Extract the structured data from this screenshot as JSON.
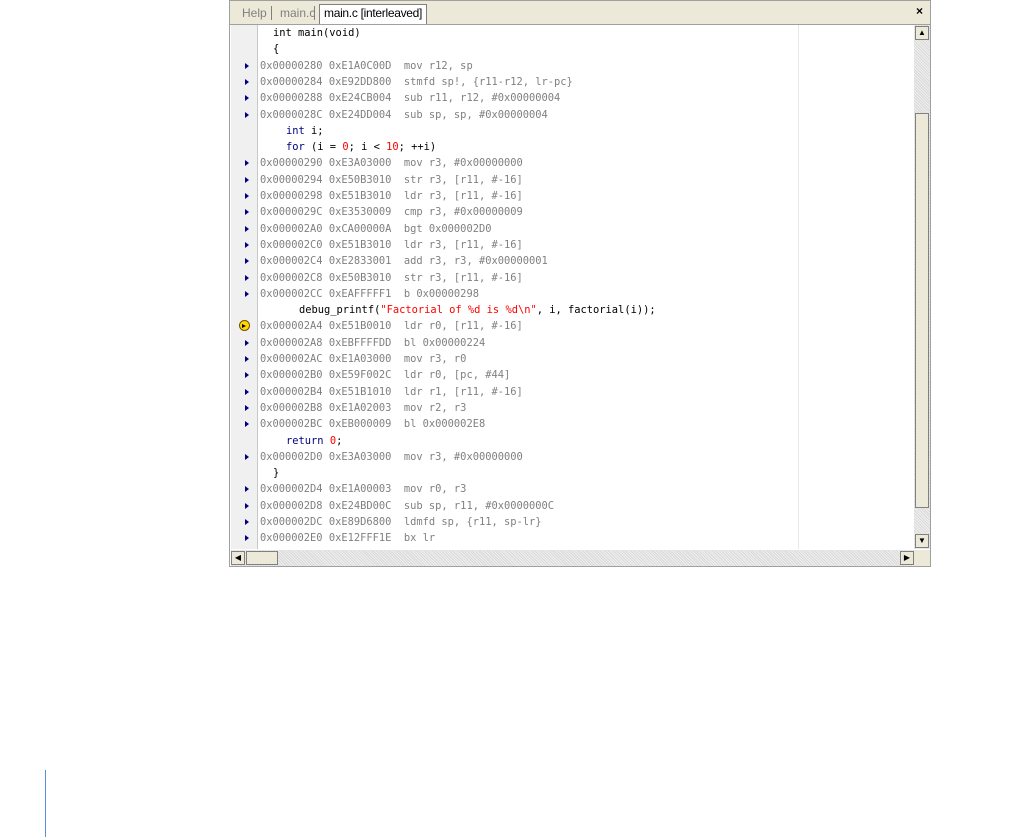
{
  "tabs": [
    {
      "label": "Help",
      "active": false
    },
    {
      "label": "main.c",
      "active": false
    },
    {
      "label": "main.c [interleaved]",
      "active": true
    }
  ],
  "close_glyph": "×",
  "lines": [
    {
      "kind": "src",
      "indent": 1,
      "tokens": [
        {
          "t": "int main(void)",
          "c": "src"
        }
      ]
    },
    {
      "kind": "src",
      "indent": 1,
      "tokens": [
        {
          "t": "{",
          "c": "src"
        }
      ]
    },
    {
      "kind": "asm",
      "text": "0x00000280 0xE1A0C00D  mov r12, sp"
    },
    {
      "kind": "asm",
      "text": "0x00000284 0xE92DD800  stmfd sp!, {r11-r12, lr-pc}"
    },
    {
      "kind": "asm",
      "text": "0x00000288 0xE24CB004  sub r11, r12, #0x00000004"
    },
    {
      "kind": "asm",
      "text": "0x0000028C 0xE24DD004  sub sp, sp, #0x00000004"
    },
    {
      "kind": "src",
      "indent": 2,
      "tokens": [
        {
          "t": "int",
          "c": "kw"
        },
        {
          "t": " i;",
          "c": "src"
        }
      ]
    },
    {
      "kind": "src",
      "indent": 2,
      "tokens": [
        {
          "t": "for",
          "c": "kw"
        },
        {
          "t": " (i = ",
          "c": "src"
        },
        {
          "t": "0",
          "c": "num"
        },
        {
          "t": "; i < ",
          "c": "src"
        },
        {
          "t": "10",
          "c": "num"
        },
        {
          "t": "; ++i)",
          "c": "src"
        }
      ]
    },
    {
      "kind": "asm",
      "text": "0x00000290 0xE3A03000  mov r3, #0x00000000"
    },
    {
      "kind": "asm",
      "text": "0x00000294 0xE50B3010  str r3, [r11, #-16]"
    },
    {
      "kind": "asm",
      "text": "0x00000298 0xE51B3010  ldr r3, [r11, #-16]"
    },
    {
      "kind": "asm",
      "text": "0x0000029C 0xE3530009  cmp r3, #0x00000009"
    },
    {
      "kind": "asm",
      "text": "0x000002A0 0xCA00000A  bgt 0x000002D0"
    },
    {
      "kind": "asm",
      "text": "0x000002C0 0xE51B3010  ldr r3, [r11, #-16]"
    },
    {
      "kind": "asm",
      "text": "0x000002C4 0xE2833001  add r3, r3, #0x00000001"
    },
    {
      "kind": "asm",
      "text": "0x000002C8 0xE50B3010  str r3, [r11, #-16]"
    },
    {
      "kind": "asm",
      "text": "0x000002CC 0xEAFFFFF1  b 0x00000298"
    },
    {
      "kind": "src",
      "indent": 3,
      "tokens": [
        {
          "t": "debug_printf(",
          "c": "src"
        },
        {
          "t": "\"Factorial of %d is %d\\n\"",
          "c": "str"
        },
        {
          "t": ", i, factorial(i));",
          "c": "src"
        }
      ]
    },
    {
      "kind": "asm",
      "pc": true,
      "text": "0x000002A4 0xE51B0010  ldr r0, [r11, #-16]"
    },
    {
      "kind": "asm",
      "text": "0x000002A8 0xEBFFFFDD  bl 0x00000224"
    },
    {
      "kind": "asm",
      "text": "0x000002AC 0xE1A03000  mov r3, r0"
    },
    {
      "kind": "asm",
      "text": "0x000002B0 0xE59F002C  ldr r0, [pc, #44]"
    },
    {
      "kind": "asm",
      "text": "0x000002B4 0xE51B1010  ldr r1, [r11, #-16]"
    },
    {
      "kind": "asm",
      "text": "0x000002B8 0xE1A02003  mov r2, r3"
    },
    {
      "kind": "asm",
      "text": "0x000002BC 0xEB000009  bl 0x000002E8"
    },
    {
      "kind": "src",
      "indent": 2,
      "tokens": [
        {
          "t": "return",
          "c": "kw"
        },
        {
          "t": " ",
          "c": "src"
        },
        {
          "t": "0",
          "c": "num"
        },
        {
          "t": ";",
          "c": "src"
        }
      ]
    },
    {
      "kind": "asm",
      "text": "0x000002D0 0xE3A03000  mov r3, #0x00000000"
    },
    {
      "kind": "src",
      "indent": 1,
      "tokens": [
        {
          "t": "}",
          "c": "src"
        }
      ]
    },
    {
      "kind": "asm",
      "text": "0x000002D4 0xE1A00003  mov r0, r3"
    },
    {
      "kind": "asm",
      "text": "0x000002D8 0xE24BD00C  sub sp, r11, #0x0000000C"
    },
    {
      "kind": "asm",
      "text": "0x000002DC 0xE89D6800  ldmfd sp, {r11, sp-lr}"
    },
    {
      "kind": "asm",
      "text": "0x000002E0 0xE12FFF1E  bx lr"
    }
  ],
  "icons": {
    "step": "step-arrow-icon",
    "pc": "current-pc-icon",
    "scroll_up": "▲",
    "scroll_down": "▼",
    "scroll_left": "◀",
    "scroll_right": "▶"
  }
}
